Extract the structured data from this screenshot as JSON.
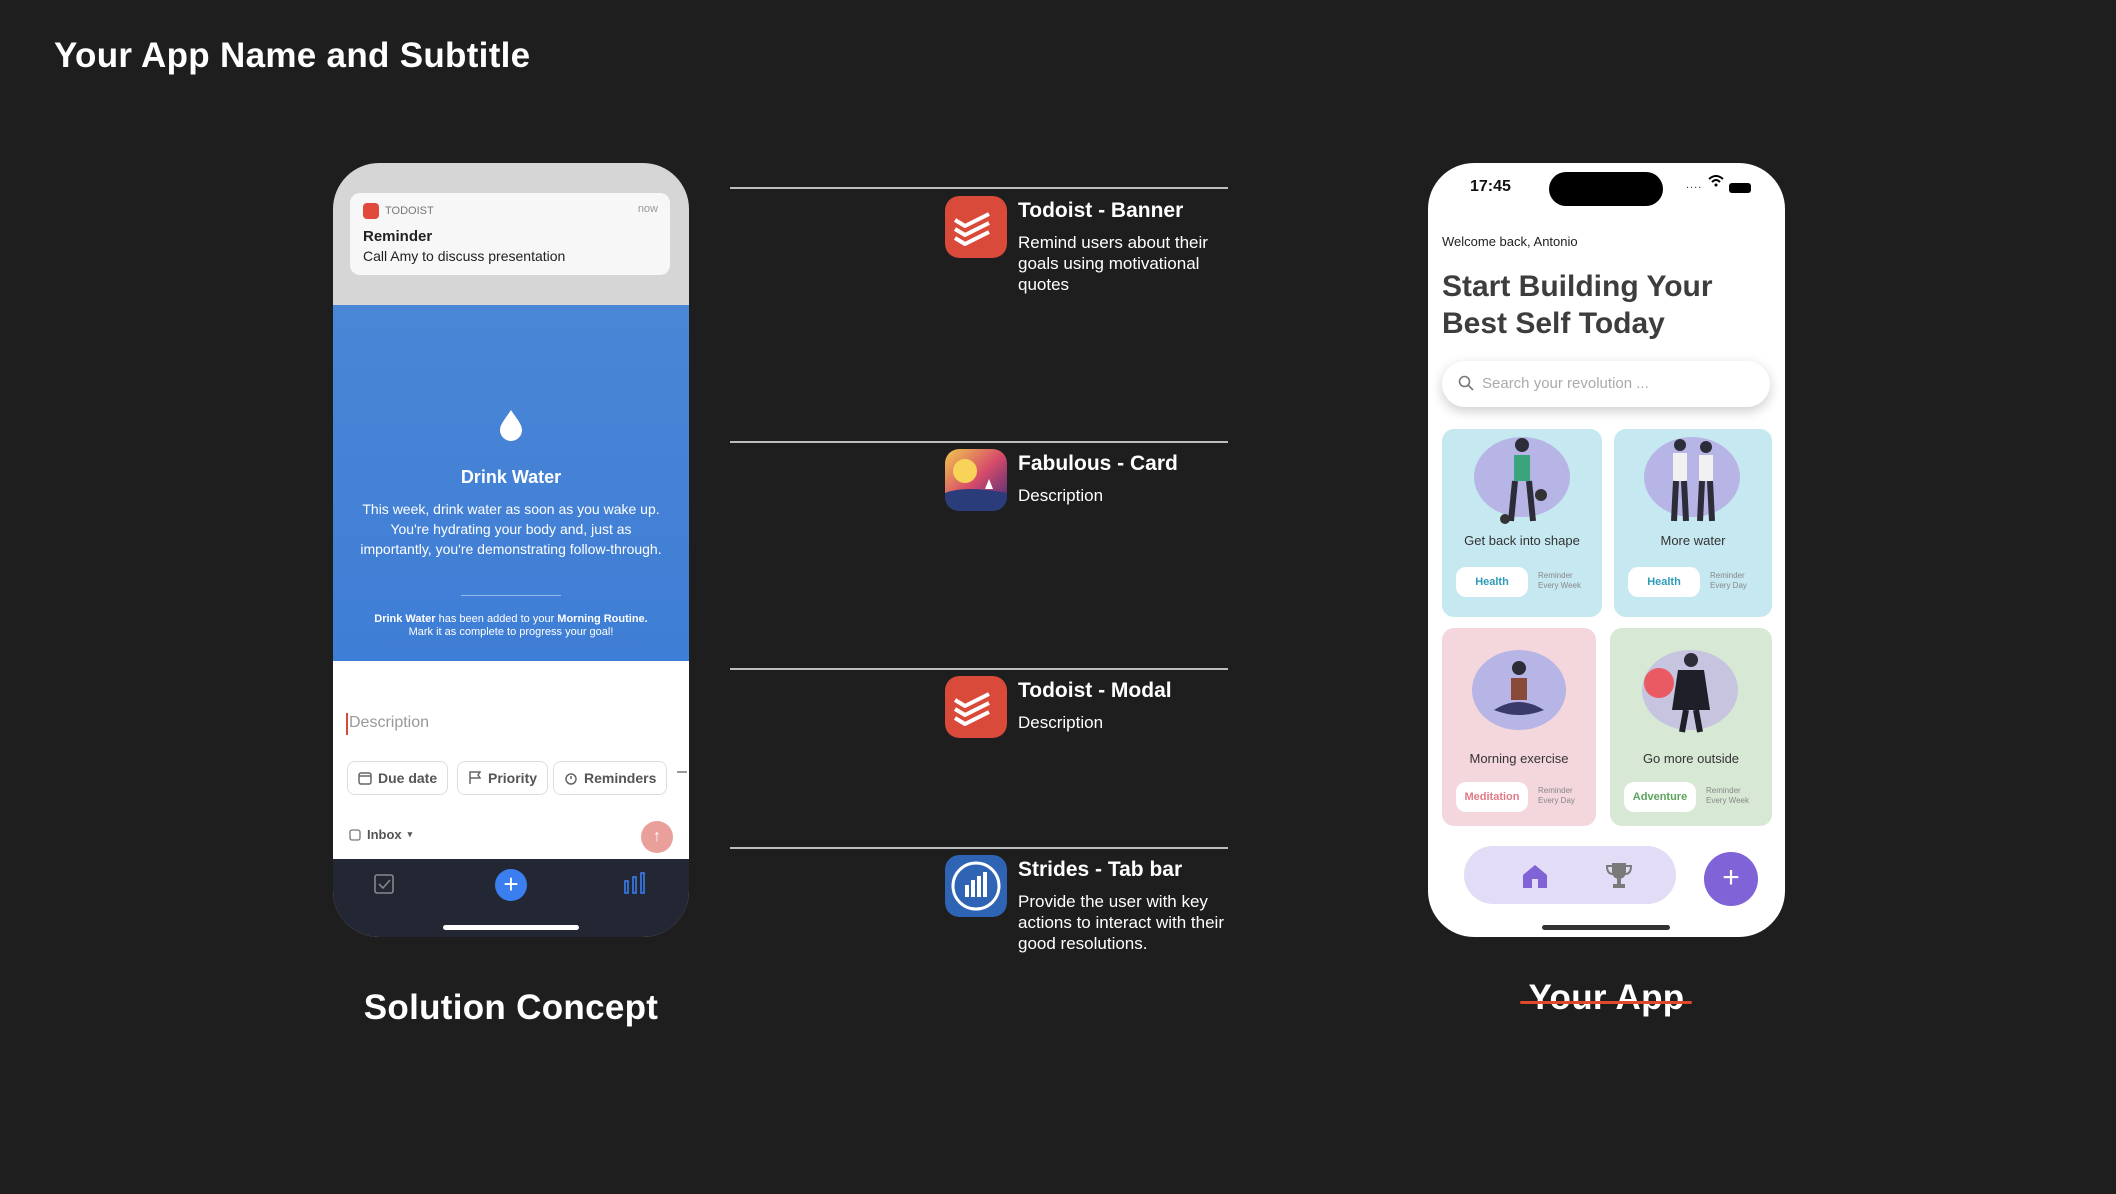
{
  "header": {
    "title": "Your App Name and Subtitle"
  },
  "concept": {
    "caption": "Solution Concept",
    "notification": {
      "app": "TODOIST",
      "time": "now",
      "title": "Reminder",
      "body": "Call Amy to discuss presentation"
    },
    "habit": {
      "title": "Drink Water",
      "body": "This week, drink water as soon as you wake up. You're hydrating your body and, just as importantly, you're demonstrating follow-through.",
      "note_strong1": "Drink Water",
      "note_mid": " has been added to your ",
      "note_strong2": "Morning Routine.",
      "note_tail": "Mark it as complete to progress your goal!"
    },
    "composer": {
      "placeholder": "Description",
      "chips": [
        "Due date",
        "Priority",
        "Reminders"
      ],
      "project": "Inbox"
    }
  },
  "inspirations": [
    {
      "title": "Todoist - Banner",
      "description": "Remind users about their goals using motivational quotes",
      "icon": "todoist-icon",
      "color": "#d94a3b"
    },
    {
      "title": "Fabulous - Card",
      "description": "Description",
      "icon": "fabulous-icon",
      "color": "#e8c34a"
    },
    {
      "title": "Todoist - Modal",
      "description": "Description",
      "icon": "todoist-icon",
      "color": "#d94a3b"
    },
    {
      "title": "Strides - Tab bar",
      "description": "Provide the user with key actions to interact with their good resolutions.",
      "icon": "strides-icon",
      "color": "#2f63b3"
    }
  ],
  "app": {
    "caption": "Your App",
    "status": {
      "time": "17:45"
    },
    "welcome": "Welcome back, Antonio",
    "headline": "Start Building Your Best Self Today",
    "search_placeholder": "Search your revolution ...",
    "cards": [
      {
        "label": "Get back into shape",
        "tag": "Health",
        "reminder1": "Reminder",
        "reminder2": "Every Week",
        "bg": "#c6e8f0",
        "tag_color": "#2f9bb8"
      },
      {
        "label": "More water",
        "tag": "Health",
        "reminder1": "Reminder",
        "reminder2": "Every Day",
        "bg": "#c6e8f0",
        "tag_color": "#2f9bb8"
      },
      {
        "label": "Morning exercise",
        "tag": "Meditation",
        "reminder1": "Reminder",
        "reminder2": "Every Day",
        "bg": "#f3d7dc",
        "tag_color": "#e07a86"
      },
      {
        "label": "Go more outside",
        "tag": "Adventure",
        "reminder1": "Reminder",
        "reminder2": "Every Week",
        "bg": "#d7e8d4",
        "tag_color": "#5aa35c"
      }
    ],
    "accent": "#8063d7"
  }
}
